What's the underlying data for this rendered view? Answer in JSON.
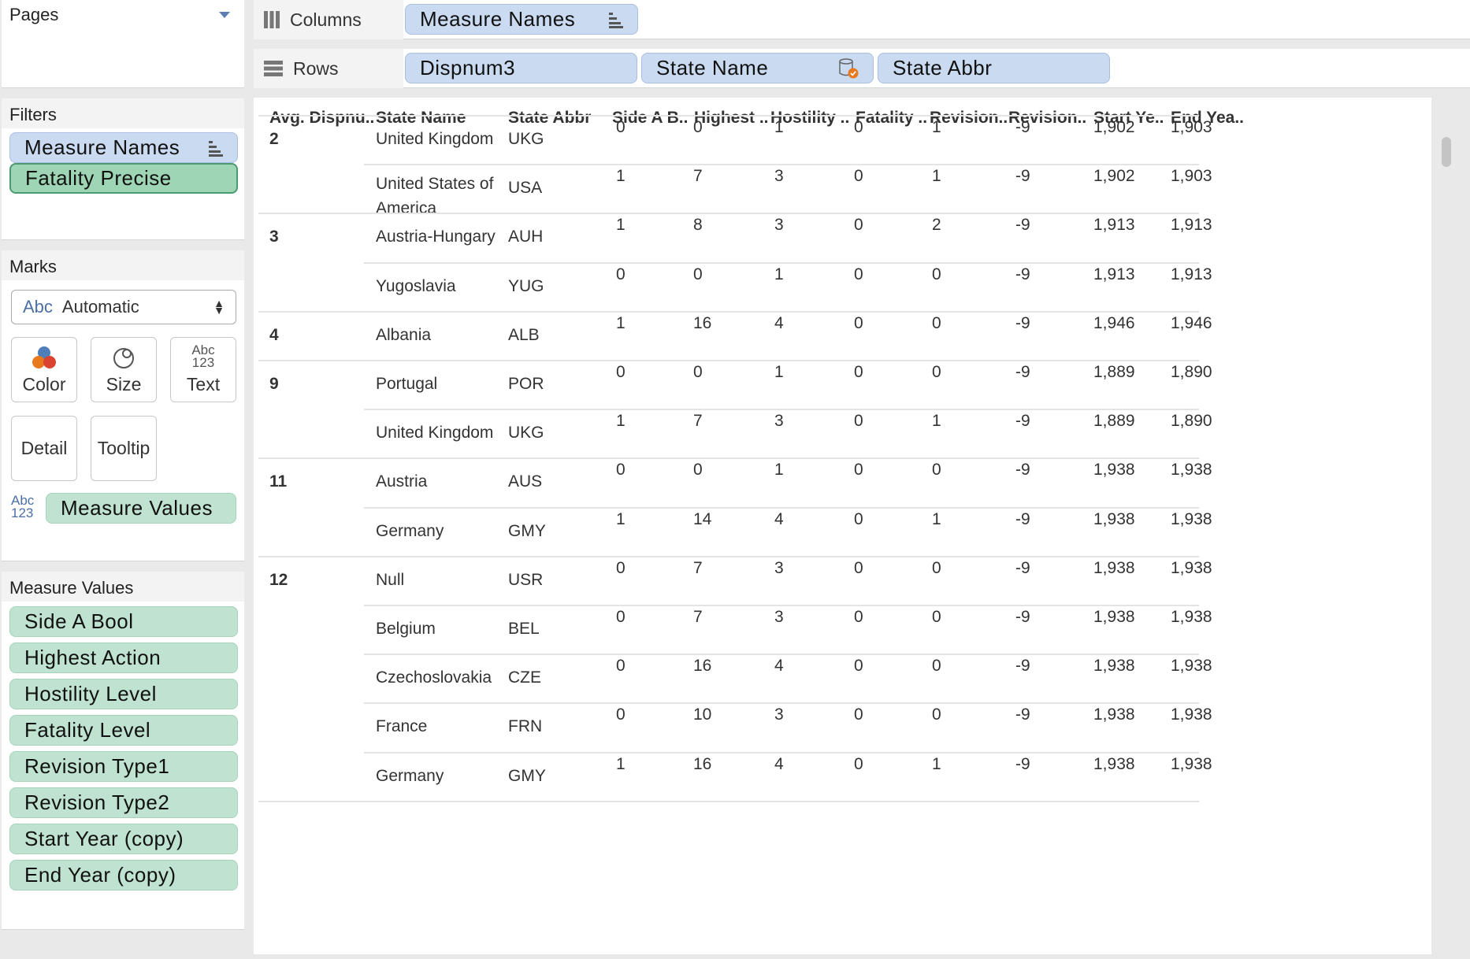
{
  "pages": {
    "title": "Pages"
  },
  "filters": {
    "title": "Filters",
    "items": [
      "Measure Names",
      "Fatality Precise"
    ]
  },
  "marks": {
    "title": "Marks",
    "type_icon": "Abc",
    "type": "Automatic",
    "buttons": {
      "color": "Color",
      "size": "Size",
      "text": "Text",
      "detail": "Detail",
      "tooltip": "Tooltip"
    },
    "text_icon_top": "Abc",
    "text_icon_bottom": "123",
    "pill": "Measure Values"
  },
  "measure_values": {
    "title": "Measure Values",
    "items": [
      "Side A Bool",
      "Highest Action",
      "Hostility Level",
      "Fatality Level",
      "Revision Type1",
      "Revision Type2",
      "Start Year (copy)",
      "End Year (copy)"
    ]
  },
  "columns_shelf": {
    "label": "Columns",
    "pills": [
      "Measure Names"
    ]
  },
  "rows_shelf": {
    "label": "Rows",
    "pills": [
      "Dispnum3",
      "State Name",
      "State Abbr"
    ]
  },
  "table": {
    "headers": [
      "Avg. Dispnu..",
      "State Name",
      "State Abbr",
      "Side A B..",
      "Highest ..",
      "Hostility ..",
      "Fatality ..",
      "Revision..",
      "Revision..",
      "Start Ye..",
      "End Yea.."
    ],
    "rows": [
      {
        "group": "2",
        "state": "United Kingdom",
        "abbr": "UKG",
        "v": [
          "0",
          "0",
          "1",
          "0",
          "1",
          "-9",
          "1,902",
          "1,903"
        ]
      },
      {
        "group": "",
        "state": "United States of",
        "state2": "America",
        "abbr": "USA",
        "v": [
          "1",
          "7",
          "3",
          "0",
          "1",
          "-9",
          "1,902",
          "1,903"
        ]
      },
      {
        "group": "3",
        "state": "Austria-Hungary",
        "abbr": "AUH",
        "v": [
          "1",
          "8",
          "3",
          "0",
          "2",
          "-9",
          "1,913",
          "1,913"
        ]
      },
      {
        "group": "",
        "state": "Yugoslavia",
        "abbr": "YUG",
        "v": [
          "0",
          "0",
          "1",
          "0",
          "0",
          "-9",
          "1,913",
          "1,913"
        ]
      },
      {
        "group": "4",
        "state": "Albania",
        "abbr": "ALB",
        "v": [
          "1",
          "16",
          "4",
          "0",
          "0",
          "-9",
          "1,946",
          "1,946"
        ]
      },
      {
        "group": "9",
        "state": "Portugal",
        "abbr": "POR",
        "v": [
          "0",
          "0",
          "1",
          "0",
          "0",
          "-9",
          "1,889",
          "1,890"
        ]
      },
      {
        "group": "",
        "state": "United Kingdom",
        "abbr": "UKG",
        "v": [
          "1",
          "7",
          "3",
          "0",
          "1",
          "-9",
          "1,889",
          "1,890"
        ]
      },
      {
        "group": "11",
        "state": "Austria",
        "abbr": "AUS",
        "v": [
          "0",
          "0",
          "1",
          "0",
          "0",
          "-9",
          "1,938",
          "1,938"
        ]
      },
      {
        "group": "",
        "state": "Germany",
        "abbr": "GMY",
        "v": [
          "1",
          "14",
          "4",
          "0",
          "1",
          "-9",
          "1,938",
          "1,938"
        ]
      },
      {
        "group": "12",
        "state": "Null",
        "abbr": "USR",
        "v": [
          "0",
          "7",
          "3",
          "0",
          "0",
          "-9",
          "1,938",
          "1,938"
        ]
      },
      {
        "group": "",
        "state": "Belgium",
        "abbr": "BEL",
        "v": [
          "0",
          "7",
          "3",
          "0",
          "0",
          "-9",
          "1,938",
          "1,938"
        ]
      },
      {
        "group": "",
        "state": "Czechoslovakia",
        "abbr": "CZE",
        "v": [
          "0",
          "16",
          "4",
          "0",
          "0",
          "-9",
          "1,938",
          "1,938"
        ]
      },
      {
        "group": "",
        "state": "France",
        "abbr": "FRN",
        "v": [
          "0",
          "10",
          "3",
          "0",
          "0",
          "-9",
          "1,938",
          "1,938"
        ]
      },
      {
        "group": "",
        "state": "Germany",
        "abbr": "GMY",
        "v": [
          "1",
          "16",
          "4",
          "0",
          "1",
          "-9",
          "1,938",
          "1,938"
        ]
      }
    ]
  },
  "colors": {
    "blue_pill": "#c9daf1",
    "green_pill": "#bfe3d0",
    "accent_orange": "#e8791d"
  }
}
